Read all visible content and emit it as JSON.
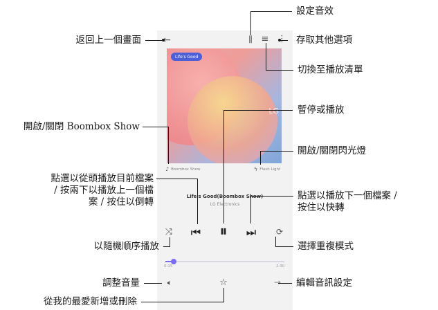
{
  "annotations": {
    "set_sound_effect": "設定音效",
    "go_back": "返回上一個畫面",
    "more_options": "存取其他選項",
    "switch_playlist": "切換至播放清單",
    "boombox": "開啟/關閉 Boombox Show",
    "pause_play": "暫停或播放",
    "flash": "開啟/關閉閃光燈",
    "prev_line1": "點選以從頭播放目前檔案",
    "prev_line2": "/ 按兩下以播放上一個檔",
    "prev_line3": "案 / 按住以倒轉",
    "next_line1": "點選以播放下一個檔案 /",
    "next_line2": "按住以快轉",
    "shuffle": "以隨機順序播放",
    "repeat": "選擇重複模式",
    "volume": "調整音量",
    "edit_audio": "編輯音訊設定",
    "favorite": "從我的最愛新增或刪除"
  },
  "player": {
    "album_tag": "Life's Good",
    "album_side_text": "LG",
    "boombox_label": "Boombox Show",
    "flash_label": "Flash Light",
    "song_title": "Life's Good(Boombox Show)",
    "artist": "LG Electronics",
    "time_elapsed": "0:15",
    "time_total": "2:30",
    "progress": 0.07
  },
  "icons": {
    "back": "arrow-left-icon",
    "equalizer": "equalizer-icon",
    "playlist": "playlist-icon",
    "more": "more-vertical-icon",
    "shuffle": "shuffle-icon",
    "prev": "skip-previous-icon",
    "pause": "pause-icon",
    "next": "skip-next-icon",
    "repeat": "repeat-icon",
    "volume": "volume-icon",
    "favorite": "star-icon",
    "edit": "edit-arrow-icon"
  },
  "colors": {
    "accent": "#7b6cf6",
    "album_pink": "#f08f8f",
    "album_blue": "#7ea6d8",
    "album_yellow": "#f3d98a",
    "control_dark": "#222222"
  }
}
